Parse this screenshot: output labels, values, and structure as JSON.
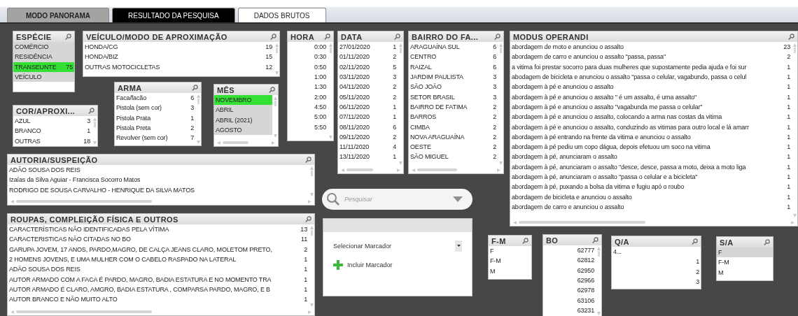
{
  "tabs": [
    {
      "label": "MODO PANORAMA",
      "selected": true,
      "color": "#a3a3a3"
    },
    {
      "label": "RESULTADO DA PESQUISA",
      "selected": false,
      "color": "#000000"
    },
    {
      "label": "DADOS BRUTOS",
      "selected": false,
      "color": "#ffffff"
    }
  ],
  "lists": [
    {
      "title": "ESPÉCIE",
      "items": [
        {
          "label": "COMÉRCIO",
          "selected": false,
          "excluded": true
        },
        {
          "label": "RESIDÊNCIA",
          "selected": false,
          "excluded": true
        },
        {
          "label": "TRANSEUNTE",
          "count": "75",
          "selected": true,
          "excluded": false
        },
        {
          "label": "VEÍCULO",
          "selected": false,
          "excluded": true
        }
      ]
    },
    {
      "title": "VEÍCULO/MODO DE APROXIMAÇÃO",
      "scroll_v": true,
      "items": [
        {
          "label": "HONDA/CG",
          "count": "19",
          "selected": false,
          "excluded": false
        },
        {
          "label": "HONDA/BIZ",
          "count": "15",
          "selected": false,
          "excluded": false
        },
        {
          "label": "OUTRAS MOTOCICLETAS",
          "count": "12",
          "selected": false,
          "excluded": false
        }
      ]
    },
    {
      "title": "COR/APROXI...",
      "scroll_v": true,
      "items": [
        {
          "label": "AZUL",
          "count": "3",
          "selected": false,
          "excluded": false
        },
        {
          "label": "BRANCO",
          "count": "1",
          "selected": false,
          "excluded": false
        },
        {
          "label": "OUTRAS",
          "count": "18",
          "selected": false,
          "excluded": false
        }
      ]
    },
    {
      "title": "ARMA",
      "scroll_v": true,
      "items": [
        {
          "label": "Faca/facão",
          "count": "6",
          "selected": false,
          "excluded": false
        },
        {
          "label": "Pistola (sem cor)",
          "count": "3",
          "selected": false,
          "excluded": false
        },
        {
          "label": "Pistola Prata",
          "count": "1",
          "selected": false,
          "excluded": false
        },
        {
          "label": "Pistola Preta",
          "count": "2",
          "selected": false,
          "excluded": false
        },
        {
          "label": "Revolver (sem cor)",
          "count": "7",
          "selected": false,
          "excluded": false
        }
      ]
    },
    {
      "title": "MÊS",
      "scroll_v": true,
      "scroll_h": true,
      "items": [
        {
          "label": "NOVEMBRO",
          "selected": true,
          "excluded": false
        },
        {
          "label": "ABRIL",
          "selected": false,
          "excluded": true
        },
        {
          "label": "ABRIL (2021)",
          "selected": false,
          "excluded": true
        },
        {
          "label": "AGOSTO",
          "selected": false,
          "excluded": true
        }
      ]
    },
    {
      "title": "HORA",
      "scroll_v": true,
      "items": [
        {
          "label": "0:00",
          "kind": "number",
          "selected": false,
          "excluded": false
        },
        {
          "label": "0:30",
          "kind": "number",
          "selected": false,
          "excluded": false
        },
        {
          "label": "0:50",
          "kind": "number",
          "selected": false,
          "excluded": false
        },
        {
          "label": "1:00",
          "kind": "number",
          "selected": false,
          "excluded": false
        },
        {
          "label": "1:30",
          "kind": "number",
          "selected": false,
          "excluded": false
        },
        {
          "label": "2:00",
          "kind": "number",
          "selected": false,
          "excluded": false
        },
        {
          "label": "4:50",
          "kind": "number",
          "selected": false,
          "excluded": false
        },
        {
          "label": "5:00",
          "kind": "number",
          "selected": false,
          "excluded": false
        },
        {
          "label": "5:50",
          "kind": "number",
          "selected": false,
          "excluded": false
        }
      ]
    },
    {
      "title": "DATA",
      "scroll_v": true,
      "scroll_h": true,
      "items": [
        {
          "label": "27/01/2020",
          "count": "1",
          "selected": false,
          "excluded": false
        },
        {
          "label": "01/11/2020",
          "count": "2",
          "selected": false,
          "excluded": false
        },
        {
          "label": "02/11/2020",
          "count": "5",
          "selected": false,
          "excluded": false
        },
        {
          "label": "03/11/2020",
          "count": "3",
          "selected": false,
          "excluded": false
        },
        {
          "label": "04/11/2020",
          "count": "2",
          "selected": false,
          "excluded": false
        },
        {
          "label": "05/11/2020",
          "count": "2",
          "selected": false,
          "excluded": false
        },
        {
          "label": "06/11/2020",
          "count": "1",
          "selected": false,
          "excluded": false
        },
        {
          "label": "07/11/2020",
          "count": "1",
          "selected": false,
          "excluded": false
        },
        {
          "label": "08/11/2020",
          "count": "6",
          "selected": false,
          "excluded": false
        },
        {
          "label": "09/11/2020",
          "count": "2",
          "selected": false,
          "excluded": false
        },
        {
          "label": "11/11/2020",
          "count": "4",
          "selected": false,
          "excluded": false
        },
        {
          "label": "13/11/2020",
          "count": "1",
          "selected": false,
          "excluded": false
        }
      ]
    },
    {
      "title": "BAIRRO DO FA...",
      "scroll_v": true,
      "scroll_h": true,
      "items": [
        {
          "label": "ARAGUAÍNA SUL",
          "count": "6",
          "selected": false,
          "excluded": false
        },
        {
          "label": "CENTRO",
          "count": "6",
          "selected": false,
          "excluded": false
        },
        {
          "label": "RAIZAL",
          "count": "6",
          "selected": false,
          "excluded": false
        },
        {
          "label": "JARDIM PAULISTA",
          "count": "3",
          "selected": false,
          "excluded": false
        },
        {
          "label": "SÃO JOÃO",
          "count": "3",
          "selected": false,
          "excluded": false
        },
        {
          "label": "SETOR BRASIL",
          "count": "3",
          "selected": false,
          "excluded": false
        },
        {
          "label": "BAIRRO DE FATIMA",
          "count": "2",
          "selected": false,
          "excluded": false
        },
        {
          "label": "BARROS",
          "count": "2",
          "selected": false,
          "excluded": false
        },
        {
          "label": "CIMBA",
          "count": "2",
          "selected": false,
          "excluded": false
        },
        {
          "label": "NOVA ARAGUAÍNA",
          "count": "2",
          "selected": false,
          "excluded": false
        },
        {
          "label": "OESTE",
          "count": "2",
          "selected": false,
          "excluded": false
        },
        {
          "label": "SÃO MIGUEL",
          "count": "2",
          "selected": false,
          "excluded": false
        }
      ]
    },
    {
      "title": "MODUS OPERANDI",
      "scroll_v": true,
      "scroll_h": true,
      "items": [
        {
          "label": "abordagem de moto e anunciou o assalto",
          "count": "23",
          "selected": false,
          "excluded": false
        },
        {
          "label": "abordagem de carro e anunciou o assalto \"passa, passa\"",
          "count": "2",
          "selected": false,
          "excluded": false
        },
        {
          "label": "a vitima foi prestar socorro para duas mulheres que supostamente pedia ajuda e foi sur",
          "count": "1",
          "selected": false,
          "excluded": false
        },
        {
          "label": "abodagem de bicicleta e anunciou o assalto \"passa o celular, vagabundo, passa o celul",
          "count": "1",
          "selected": false,
          "excluded": false
        },
        {
          "label": "abordagem à pé e anunciou o assalto",
          "count": "1",
          "selected": false,
          "excluded": false
        },
        {
          "label": "abordagem à pé e anunciou o assalto \" é um assalto, é uma assalto\"",
          "count": "1",
          "selected": false,
          "excluded": false
        },
        {
          "label": "abordagem à pé e anunciou o assalto \"vagabunda me passa o celular\"",
          "count": "1",
          "selected": false,
          "excluded": false
        },
        {
          "label": "abordagem à pé e anunciou o assalto, colocando a arma nas costas da vitima",
          "count": "1",
          "selected": false,
          "excluded": false
        },
        {
          "label": "abordagem à pé e anunciou o assalto, conduzindo as vitimas para outro local e lá amarr",
          "count": "1",
          "selected": false,
          "excluded": false
        },
        {
          "label": "abordagem à pé entrando na frente da vitima e anunciou o assalto",
          "count": "1",
          "selected": false,
          "excluded": false
        },
        {
          "label": "abordagem à pé pediu um copo dágua, depois efetuou um soco na vitima",
          "count": "1",
          "selected": false,
          "excluded": false
        },
        {
          "label": "abordagem à pé, anunciaram o assalto",
          "count": "1",
          "selected": false,
          "excluded": false
        },
        {
          "label": "abordagem à pé, anunciaram o assalto \"desce, desce, passa a moto, deixa a moto liga",
          "count": "1",
          "selected": false,
          "excluded": false
        },
        {
          "label": "abordagem à pé, anunciaram o assalto \"passa o celular e a bicicleta\"",
          "count": "1",
          "selected": false,
          "excluded": false
        },
        {
          "label": "abordagem à pé, puxando a bolsa da vitima e fugiu apó o roubo",
          "count": "1",
          "selected": false,
          "excluded": false
        },
        {
          "label": "abordagem de bicicleta e anunciou o assalto",
          "count": "1",
          "selected": false,
          "excluded": false
        },
        {
          "label": "abordagem de carro e anunciou o assalto",
          "count": "1",
          "selected": false,
          "excluded": false
        }
      ]
    },
    {
      "title": "AUTORIA/SUSPEIÇÃO",
      "scroll_v": true,
      "scroll_h": true,
      "items": [
        {
          "label": "ADÃO SOUSA DOS REIS",
          "selected": false,
          "excluded": false
        },
        {
          "label": "Izaías da Silva Aguiar - Francisca Socorro Matos",
          "selected": false,
          "excluded": false
        },
        {
          "label": "RODRIGO DE SOUSA CARVALHO - HENRIQUE DA SILVA MATOS",
          "selected": false,
          "excluded": false
        }
      ]
    },
    {
      "title": "ROUPAS, COMPLEIÇÃO FÍSICA E OUTROS",
      "scroll_v": true,
      "scroll_h": true,
      "items": [
        {
          "label": "CARACTERÍSTICAS NÃO IDENTIFICADAS PELA VÍTIMA",
          "count": "13",
          "selected": false,
          "excluded": false
        },
        {
          "label": "CARACTERISTICAS NÃO CITADAS NO BO",
          "count": "11",
          "selected": false,
          "excluded": false
        },
        {
          "label": "GARUPA JOVEM, 17 ANOS, PARDO,MAGRO, DE CALÇA JEANS CLARO, MOLETOM PRETO,",
          "count": "2",
          "selected": false,
          "excluded": false
        },
        {
          "label": "2 HOMENS JOVENS, E UMA MULHER COM O CABELO RASPADO NA LATERAL",
          "count": "1",
          "selected": false,
          "excluded": false
        },
        {
          "label": "ADÃO SOUSA DOS REIS",
          "count": "1",
          "selected": false,
          "excluded": false
        },
        {
          "label": "AUTOR ARMADO COM A FACA É PARDO, MAGRO, BADIA ESTATURA E NO MOMENTO TRA",
          "count": "1",
          "selected": false,
          "excluded": false
        },
        {
          "label": "AUTOR ARMADO É CLARO, AMGRO, BADIA ESTATURA , COMPARSA PARDO, MAGRO, E B",
          "count": "1",
          "selected": false,
          "excluded": false
        },
        {
          "label": "AUTOR BRANCO E NÃO MUITO ALTO",
          "count": "1",
          "selected": false,
          "excluded": false
        }
      ]
    },
    {
      "title": "F-M",
      "items": [
        {
          "label": "F",
          "selected": false,
          "excluded": false
        },
        {
          "label": "F-M",
          "selected": false,
          "excluded": false
        },
        {
          "label": "M",
          "selected": false,
          "excluded": false
        }
      ]
    },
    {
      "title": "BO",
      "scroll_v": true,
      "items": [
        {
          "label": "62777",
          "kind": "number",
          "selected": false,
          "excluded": false
        },
        {
          "label": "62812",
          "kind": "number",
          "selected": false,
          "excluded": false
        },
        {
          "label": "62950",
          "kind": "number",
          "selected": false,
          "excluded": false
        },
        {
          "label": "62966",
          "kind": "number",
          "selected": false,
          "excluded": false
        },
        {
          "label": "62978",
          "kind": "number",
          "selected": false,
          "excluded": false
        },
        {
          "label": "63106",
          "kind": "number",
          "selected": false,
          "excluded": false
        },
        {
          "label": "63231",
          "kind": "number",
          "selected": false,
          "excluded": false
        }
      ]
    },
    {
      "title": "Q/A",
      "items": [
        {
          "label": "4...",
          "kind": "text",
          "selected": false,
          "excluded": false
        },
        {
          "label": "1",
          "kind": "number",
          "selected": false,
          "excluded": false
        },
        {
          "label": "2",
          "kind": "number",
          "selected": false,
          "excluded": false
        },
        {
          "label": "3",
          "kind": "number",
          "selected": false,
          "excluded": false
        }
      ]
    },
    {
      "title": "S/A",
      "items": [
        {
          "label": "F",
          "selected": false,
          "excluded": true
        },
        {
          "label": "F-M",
          "selected": false,
          "excluded": false
        },
        {
          "label": "M",
          "selected": false,
          "excluded": false
        }
      ]
    }
  ],
  "search": {
    "placeholder": "Pesquisar"
  },
  "bookmarks": {
    "dropdown": "Selecionar Marcador",
    "add": "Incluir Marcador"
  }
}
